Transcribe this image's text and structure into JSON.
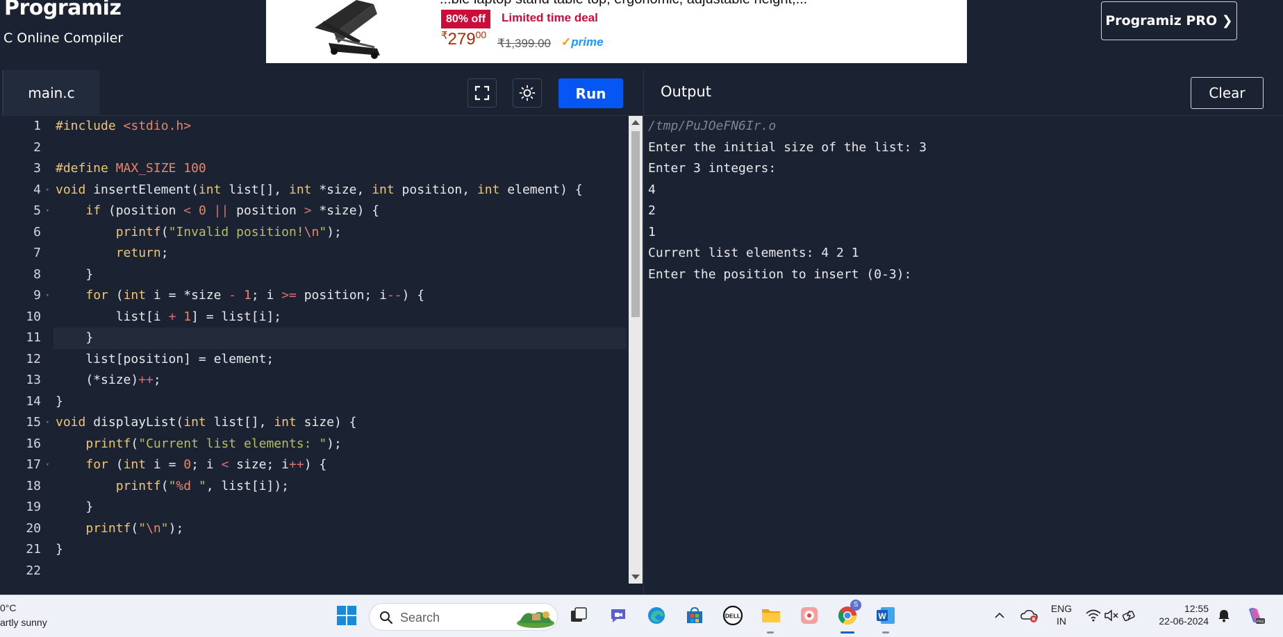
{
  "header": {
    "brand": "Programiz",
    "subtitle": "C Online Compiler",
    "pro_button": "Programiz PRO ❯"
  },
  "ad": {
    "title_fragment": "...ble laptop stand table top, ergonomic, adjustable height,...",
    "discount_badge": "80% off",
    "deal_label": "Limited time deal",
    "price_currency": "₹",
    "price_whole": "279",
    "price_fraction": "00",
    "mrp": "₹1,399.00",
    "prime_check": "✓",
    "prime_label": "prime"
  },
  "editor": {
    "file_tab": "main.c",
    "run_label": "Run",
    "active_line": 11,
    "line_numbers": [
      "1",
      "2",
      "3",
      "4",
      "5",
      "6",
      "7",
      "8",
      "9",
      "10",
      "11",
      "12",
      "13",
      "14",
      "15",
      "16",
      "17",
      "18",
      "19",
      "20",
      "21",
      "22"
    ],
    "foldable_lines": [
      4,
      5,
      9,
      15,
      17
    ],
    "code_lines": [
      "#include <stdio.h>",
      "",
      "#define MAX_SIZE 100",
      "void insertElement(int list[], int *size, int position, int element) {",
      "    if (position < 0 || position > *size) {",
      "        printf(\"Invalid position!\\n\");",
      "        return;",
      "    }",
      "    for (int i = *size - 1; i >= position; i--) {",
      "        list[i + 1] = list[i];",
      "    }",
      "    list[position] = element;",
      "    (*size)++;",
      "}",
      "void displayList(int list[], int size) {",
      "    printf(\"Current list elements: \");",
      "    for (int i = 0; i < size; i++) {",
      "        printf(\"%d \", list[i]);",
      "    }",
      "    printf(\"\\n\");",
      "}",
      ""
    ]
  },
  "output": {
    "title": "Output",
    "clear_label": "Clear",
    "lines": [
      "/tmp/PuJOeFN6Ir.o",
      "Enter the initial size of the list: 3",
      "Enter 3 integers:",
      "4",
      "2",
      "1",
      "Current list elements: 4 2 1",
      "Enter the position to insert (0-3):"
    ]
  },
  "taskbar": {
    "weather_temp": "0°C",
    "weather_desc": "artly sunny",
    "search_placeholder": "Search",
    "chrome_badge": "S",
    "language": "ENG",
    "region": "IN",
    "time": "12:55",
    "date": "22-06-2024"
  },
  "colors": {
    "background": "#1b2232",
    "run_button": "#0556f3",
    "badge_red": "#cc0c39",
    "price_red": "#b12704",
    "prime_blue": "#1a98ff"
  }
}
